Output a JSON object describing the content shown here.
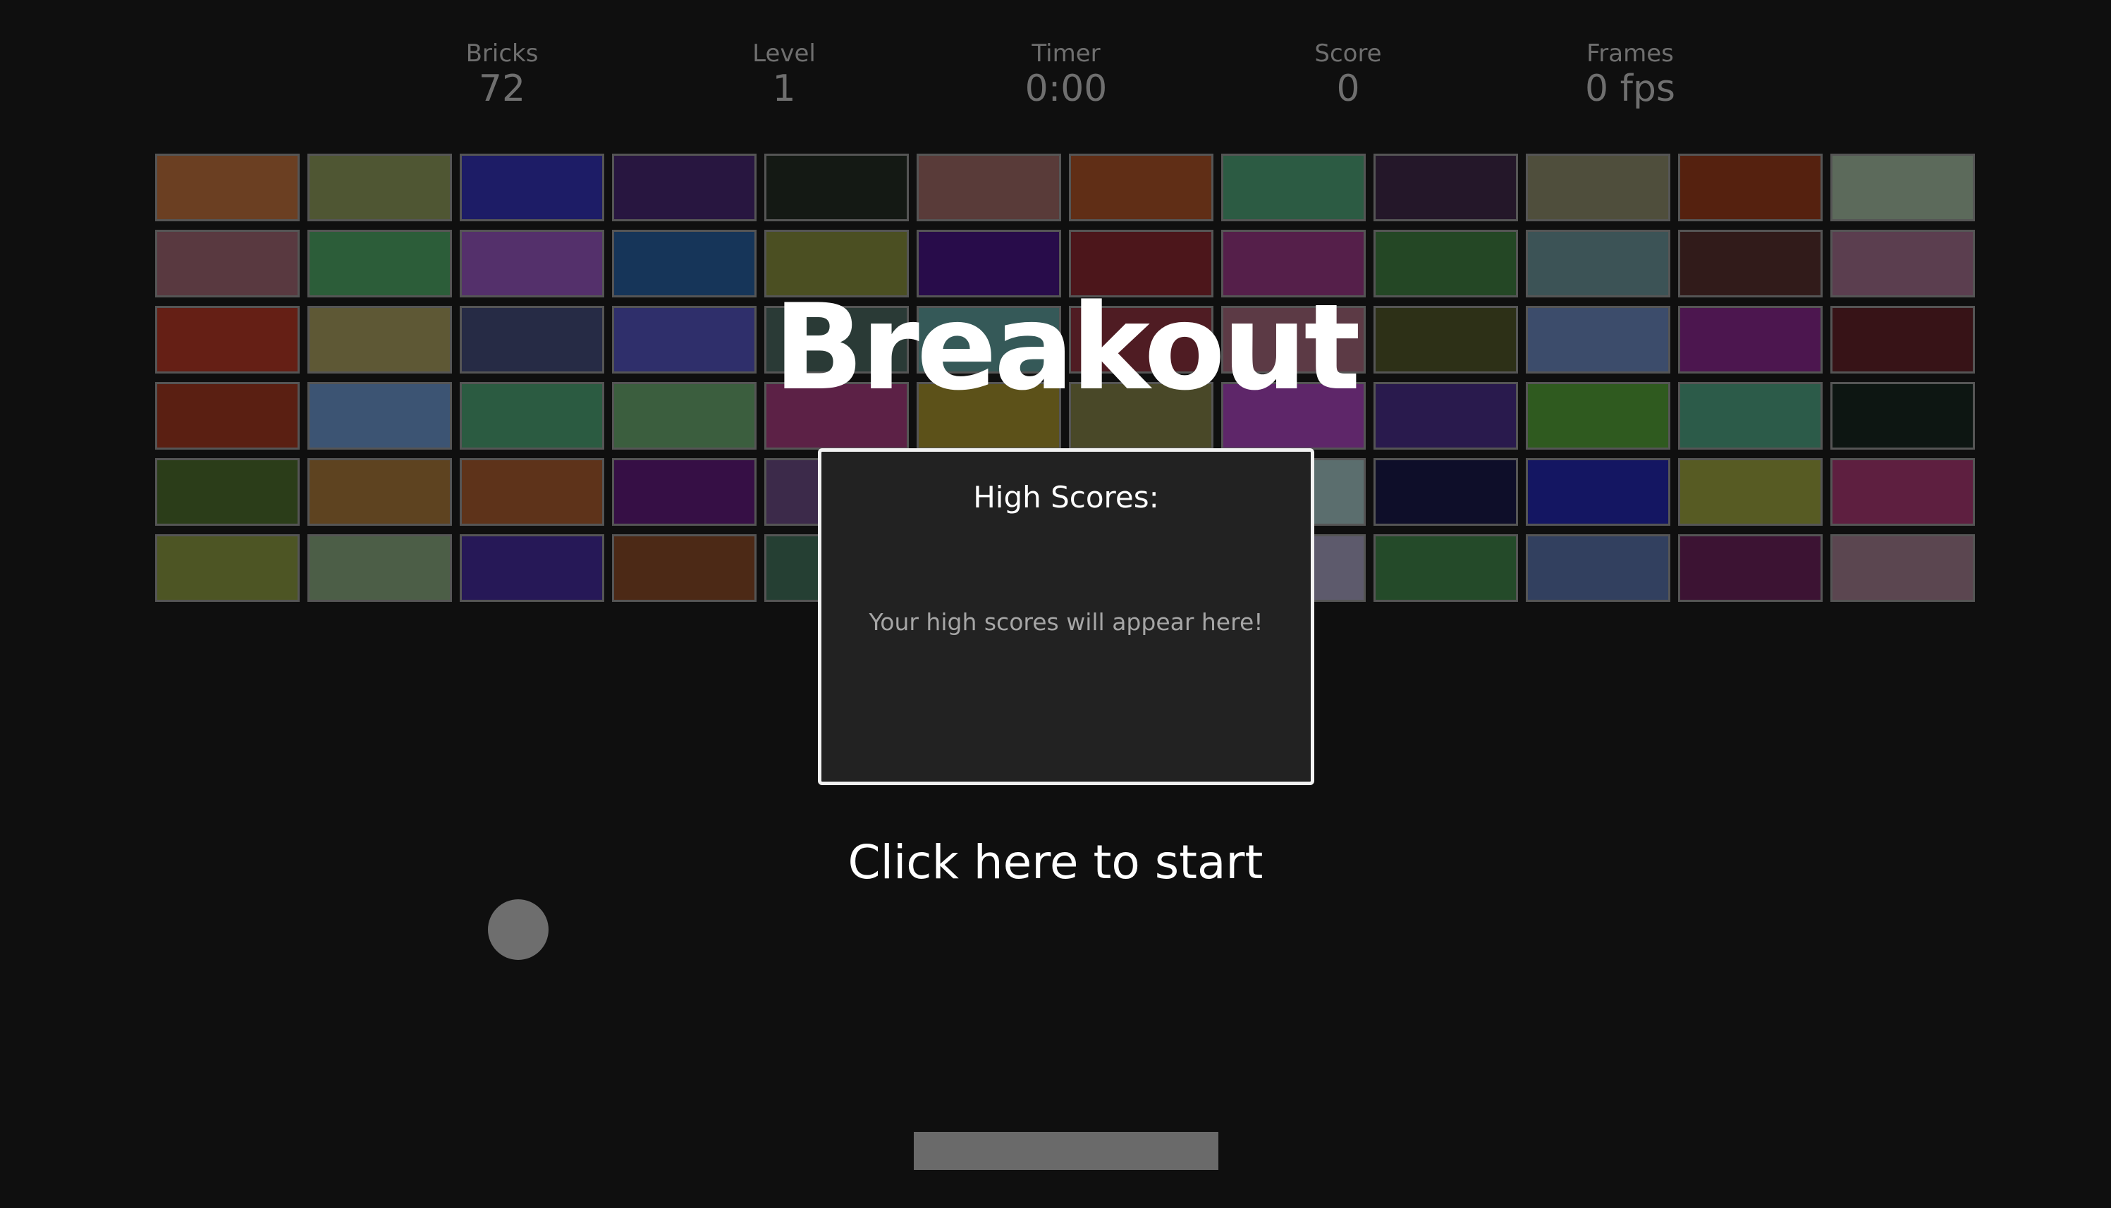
{
  "hud": {
    "bricks": {
      "label": "Bricks",
      "value": "72"
    },
    "level": {
      "label": "Level",
      "value": "1"
    },
    "timer": {
      "label": "Timer",
      "value": "0:00"
    },
    "score": {
      "label": "Score",
      "value": "0"
    },
    "frames": {
      "label": "Frames",
      "value": "0 fps"
    }
  },
  "title": "Breakout",
  "high_scores": {
    "heading": "High Scores:",
    "empty_message": "Your high scores will appear here!"
  },
  "start_prompt": "Click here to start",
  "colors": {
    "background": "#0f0f0f",
    "hud_text": "#6f6f6f",
    "panel_background": "#222222",
    "panel_border": "#f2f2f2",
    "ball": "#6e6e6e",
    "paddle": "#6a6a6a",
    "brick_border": "#555555"
  },
  "bricks": [
    [
      "#6b3f22",
      "#4f5633",
      "#1d1c66",
      "#281640",
      "#141914",
      "#593b39",
      "#602e16",
      "#2c5b43",
      "#241729",
      "#4f4e3c",
      "#55210f",
      "#5c6a5b"
    ],
    [
      "#593940",
      "#2c5d39",
      "#54306b",
      "#163559",
      "#4b4f22",
      "#280c4a",
      "#4c161b",
      "#551f4a",
      "#244725",
      "#3c5356",
      "#311b1a",
      "#5b3e4f"
    ],
    [
      "#651f15",
      "#5e5835",
      "#262b45",
      "#2f2f6b",
      "#2a3a36",
      "#355958",
      "#4f1c23",
      "#5c3a45",
      "#2d3017",
      "#3c4c6b",
      "#4c164f",
      "#371317"
    ],
    [
      "#5a1f12",
      "#3c5473",
      "#2b5b41",
      "#3b5e3e",
      "#5c2146",
      "#5c5119",
      "#494828",
      "#5e2669",
      "#291a4d",
      "#2f5a1f",
      "#2c5b49",
      "#0d1612"
    ],
    [
      "#2b3d19",
      "#5e4320",
      "#5e331a",
      "#360f45",
      "#3c2a4a",
      "#3e4b6d",
      "#4d6b5b",
      "#5b6e6e",
      "#0e0e29",
      "#141662",
      "#575b23",
      "#5e1f40"
    ],
    [
      "#4d5524",
      "#4c5e47",
      "#261857",
      "#4c2916",
      "#253f33",
      "#2b4553",
      "#4e5e63",
      "#5d5a6c",
      "#244a29",
      "#32405f",
      "#3c1333",
      "#5b4650"
    ]
  ]
}
